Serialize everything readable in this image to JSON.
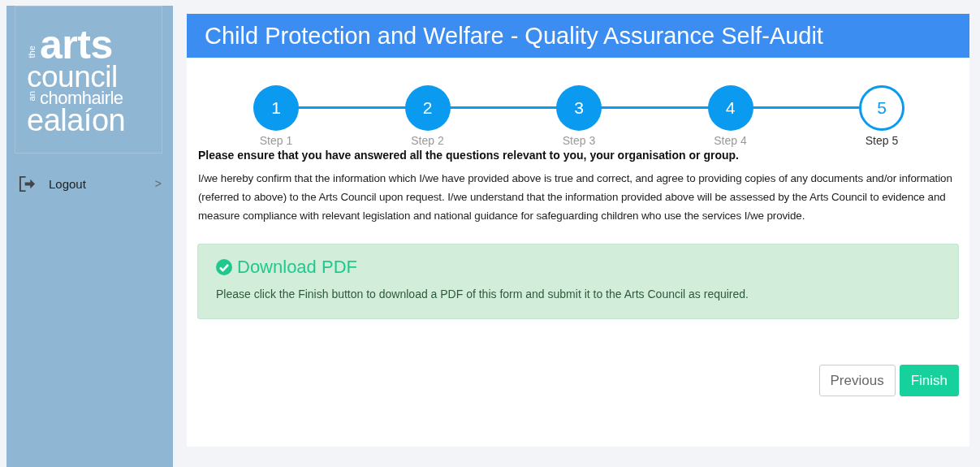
{
  "sidebar": {
    "logo": {
      "lines": [
        {
          "small": "the",
          "big": "arts"
        },
        {
          "big": "council"
        },
        {
          "small": "an",
          "big": "chomhairle"
        },
        {
          "big": "ealaíon"
        }
      ]
    },
    "items": [
      {
        "label": "Logout",
        "chevron": ">"
      }
    ]
  },
  "title": "Child Protection and Welfare - Quality Assurance Self-Audit",
  "steps": [
    {
      "number": "1",
      "label": "Step 1",
      "selected": false
    },
    {
      "number": "2",
      "label": "Step 2",
      "selected": false
    },
    {
      "number": "3",
      "label": "Step 3",
      "selected": false
    },
    {
      "number": "4",
      "label": "Step 4",
      "selected": false
    },
    {
      "number": "5",
      "label": "Step 5",
      "selected": true
    }
  ],
  "notice": "Please ensure that you have answered all the questions relevant to you, your organisation or group.",
  "declaration": "I/we hereby confirm that the information which I/we have provided above is true and correct, and agree to providing copies of any documents and/or information (referred to above) to the Arts Council upon request. I/we understand that the information provided above will be assessed by the Arts Council to evidence and measure compliance with relevant legislation and national guidance for safeguarding children who use the services I/we provide.",
  "alert": {
    "title": "Download PDF",
    "text": "Please click the Finish button to download a PDF of this form and submit it to the Arts Council as required."
  },
  "buttons": [
    {
      "label": "Previous",
      "kind": "default"
    },
    {
      "label": "Finish",
      "kind": "primary"
    }
  ]
}
